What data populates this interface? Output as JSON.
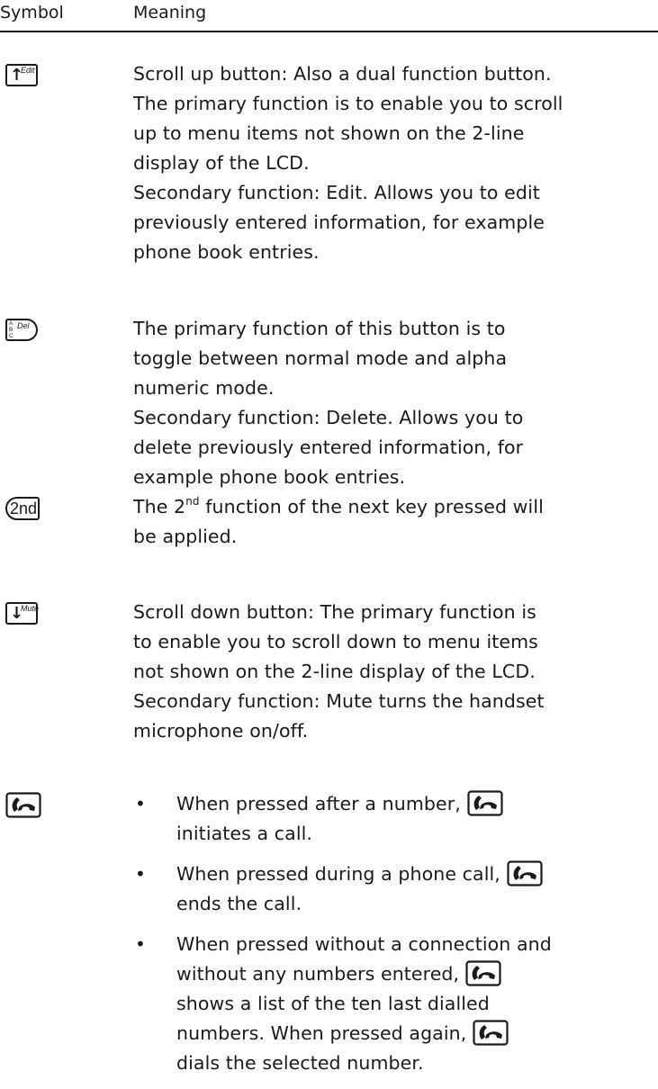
{
  "header": {
    "symbol_label": "Symbol",
    "meaning_label": "Meaning"
  },
  "rows": [
    {
      "symbol": {
        "icon": "scroll-up-icon",
        "glyph": "↑",
        "label": "Edit"
      },
      "lines": [
        "Scroll up button:  Also a dual function button.",
        "The primary function is to enable you to scroll",
        "up to menu items not shown on the 2-line",
        "display of the LCD.",
        "Secondary function: Edit. Allows you to edit",
        "previously entered information, for example",
        "phone book entries."
      ]
    },
    {
      "symbol": {
        "icon": "alpha-del-icon",
        "letters": [
          "A",
          "B",
          "C"
        ],
        "label": "Del"
      },
      "lines": [
        "The primary function of this button is to",
        "toggle between normal mode and alpha",
        "numeric mode.",
        "Secondary function: Delete. Allows you to",
        "delete previously entered information, for",
        "example phone book entries."
      ]
    },
    {
      "symbol": {
        "icon": "second-function-icon",
        "label": "2nd"
      },
      "line1_before": "The 2",
      "line1_sup": "nd",
      "line1_after": " function of the next key pressed will",
      "line2": "be applied."
    },
    {
      "symbol": {
        "icon": "scroll-down-icon",
        "glyph": "↓",
        "label": "Mute"
      },
      "lines": [
        "Scroll down button:  The primary function is",
        "to enable you to scroll down to menu items",
        "not shown on the 2-line display of the LCD.",
        "Secondary function: Mute turns the handset",
        "microphone on/off."
      ]
    },
    {
      "symbol": {
        "icon": "phone-call-icon"
      },
      "bullets": [
        {
          "l1": "When pressed after a number,",
          "l2": "initiates a call."
        },
        {
          "l1": "When pressed during a phone call,",
          "l2": "ends the call."
        },
        {
          "l1": "When pressed without a connection and",
          "l2": "without any numbers entered,",
          "l3": "shows a list of the ten last dialled",
          "l4": "numbers. When pressed again,",
          "l5": "dials the selected number."
        }
      ]
    }
  ]
}
